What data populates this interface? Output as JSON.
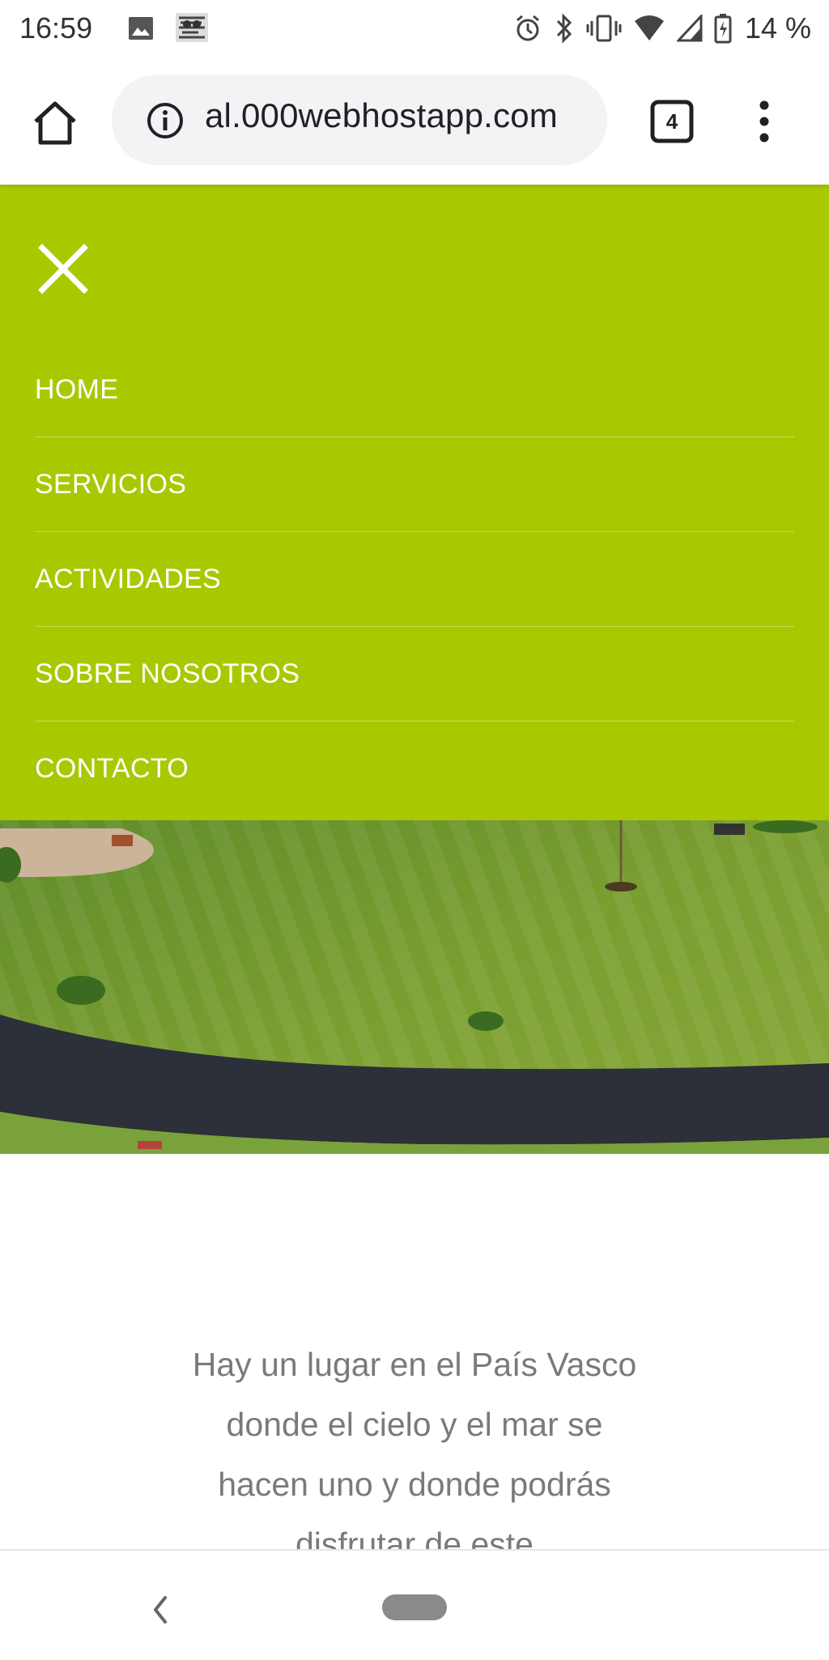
{
  "status_bar": {
    "time": "16:59",
    "battery_percent": "14 %",
    "icons": [
      "image-icon",
      "app-notification-icon",
      "alarm-icon",
      "bluetooth-icon",
      "vibrate-icon",
      "wifi-icon",
      "signal-icon",
      "battery-charging-icon"
    ]
  },
  "browser": {
    "url": "al.000webhostapp.com",
    "tab_count": "4",
    "icons": [
      "home-icon",
      "info-icon",
      "tabs-icon",
      "more-vert-icon"
    ]
  },
  "nav_menu": {
    "background": "#a8c900",
    "items": [
      {
        "label": "HOME"
      },
      {
        "label": "SERVICIOS"
      },
      {
        "label": "ACTIVIDADES"
      },
      {
        "label": "SOBRE NOSOTROS"
      },
      {
        "label": "CONTACTO"
      }
    ]
  },
  "intro": {
    "text": "Hay un lugar en el País Vasco donde el cielo y el mar se hacen uno y donde podrás disfrutar de este"
  }
}
